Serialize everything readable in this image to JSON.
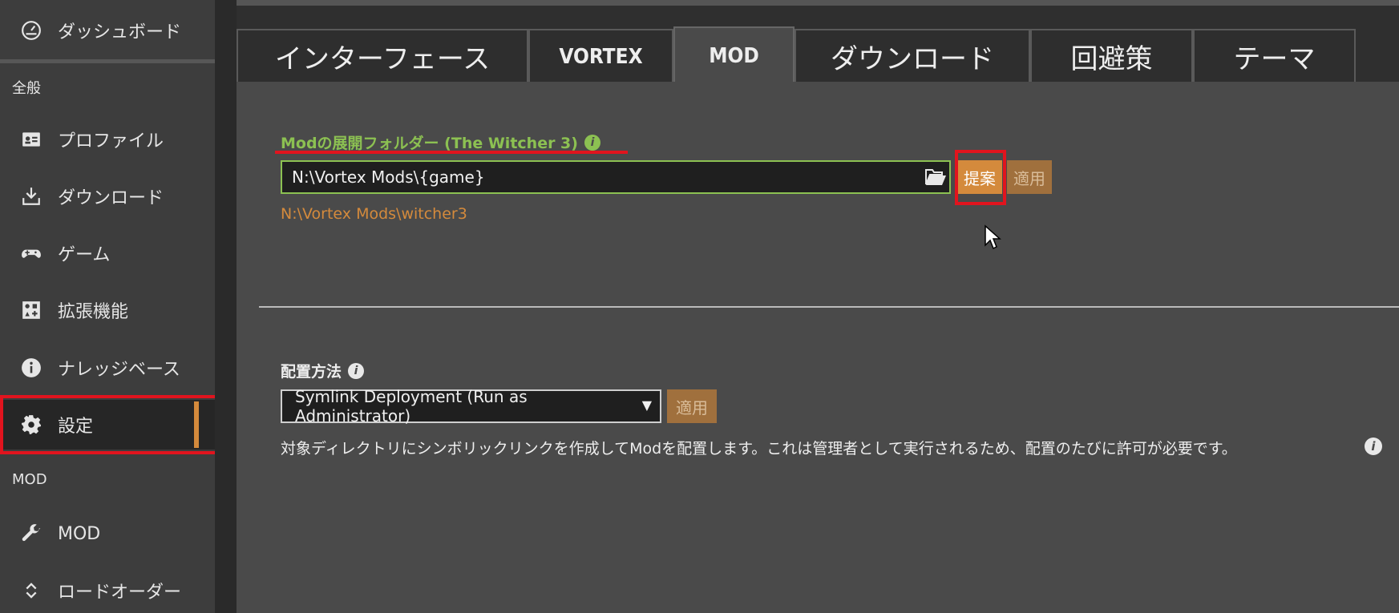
{
  "sidebar": {
    "dashboard": "ダッシュボード",
    "section_general": "全般",
    "items": [
      {
        "label": "プロファイル",
        "icon": "profile-card-icon"
      },
      {
        "label": "ダウンロード",
        "icon": "download-icon"
      },
      {
        "label": "ゲーム",
        "icon": "gamepad-icon"
      },
      {
        "label": "拡張機能",
        "icon": "extensions-icon"
      },
      {
        "label": "ナレッジベース",
        "icon": "info-circle-icon"
      },
      {
        "label": "設定",
        "icon": "gear-icon"
      }
    ],
    "section_mod": "MOD",
    "mod_items": [
      {
        "label": "MOD",
        "icon": "wrench-icon"
      },
      {
        "label": "ロードオーダー",
        "icon": "sort-icon"
      }
    ],
    "accent_color": "#d48a3c"
  },
  "tabs": [
    {
      "label": "インターフェース",
      "active": false
    },
    {
      "label": "VORTEX",
      "active": false
    },
    {
      "label": "MOD",
      "active": true
    },
    {
      "label": "ダウンロード",
      "active": false
    },
    {
      "label": "回避策",
      "active": false
    },
    {
      "label": "テーマ",
      "active": false
    }
  ],
  "mod_folder": {
    "label": "Modの展開フォルダー (The Witcher 3)",
    "value": "N:\\Vortex Mods\\{game}",
    "suggest_label": "提案",
    "apply_label": "適用",
    "resolved": "N:\\Vortex Mods\\witcher3",
    "label_color": "#8cc152"
  },
  "deployment": {
    "label": "配置方法",
    "selected": "Symlink Deployment (Run as Administrator)",
    "apply_label": "適用",
    "description": "対象ディレクトリにシンボリックリンクを作成してModを配置します。これは管理者として実行されるため、配置のたびに許可が必要です。"
  }
}
